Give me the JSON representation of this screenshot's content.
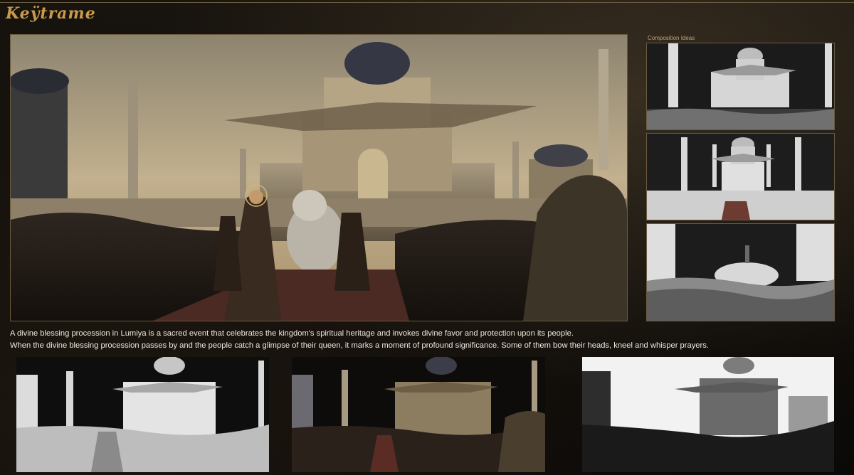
{
  "brand": "Keÿtrame",
  "composition_label": "Composition Ideas",
  "description": {
    "line1": "A divine blessing procession in Lumiya is a sacred event that celebrates the kingdom's spiritual heritage and invokes divine favor and protection upon its people.",
    "line2": "When the divine blessing procession passes by and the people catch a glimpse of their queen, it marks a moment of profound significance. Some of them bow their heads, kneel and whisper prayers."
  },
  "colors": {
    "accent": "#c99a4b",
    "border": "#6b5a3e",
    "sky": "#b9a98a",
    "clay": "#e6e6e6"
  }
}
